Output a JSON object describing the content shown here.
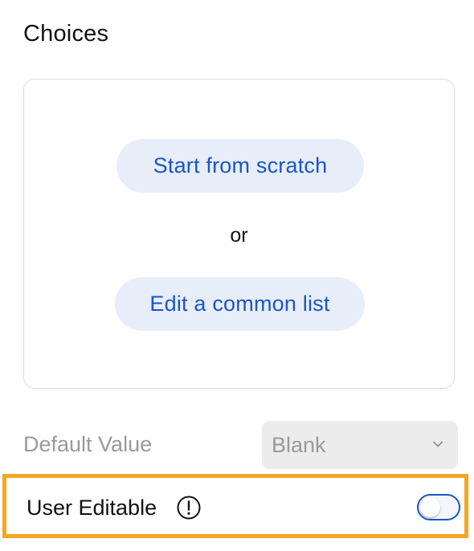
{
  "choices": {
    "title": "Choices",
    "start_button": "Start from scratch",
    "separator": "or",
    "common_list_button": "Edit a common list"
  },
  "default_value": {
    "label": "Default Value",
    "selected": "Blank"
  },
  "user_editable": {
    "label": "User Editable",
    "enabled": false
  },
  "colors": {
    "accent": "#1a56c4",
    "pill_bg": "#e8eef9",
    "highlight": "#f5a623"
  },
  "icons": {
    "info": "info-circle-icon",
    "dropdown": "chevron-down-icon"
  }
}
